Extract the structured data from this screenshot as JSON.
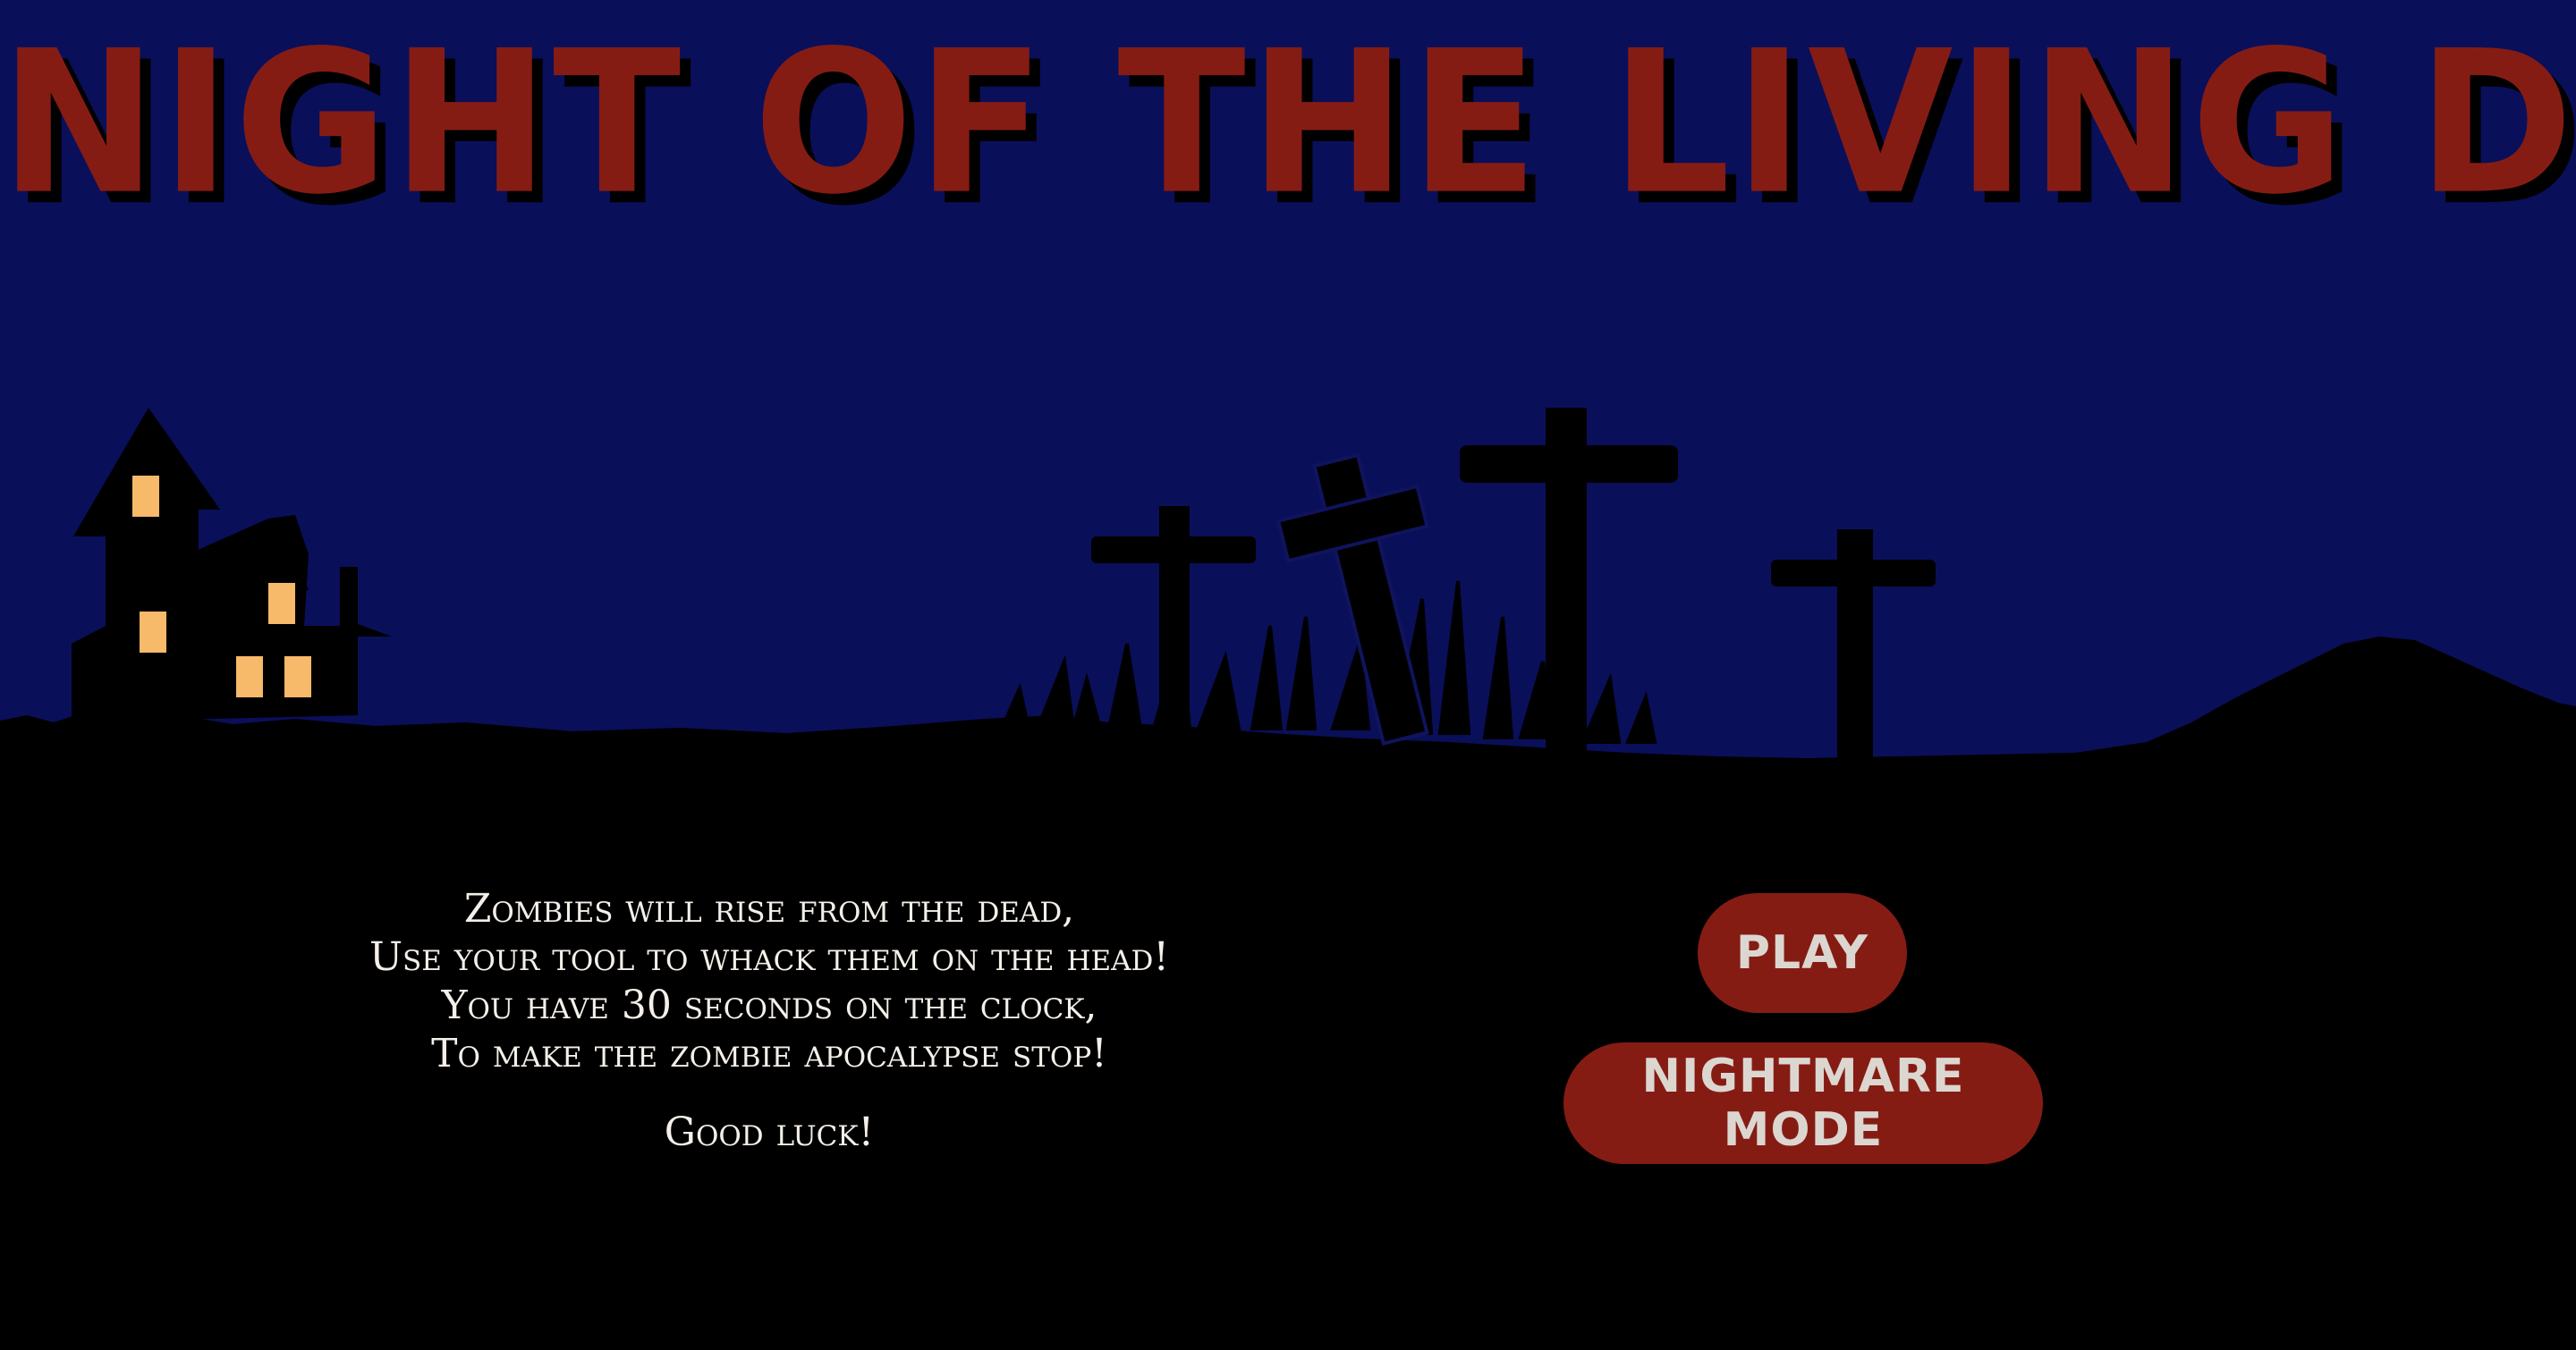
{
  "title": "NIGHT OF THE LIVING DEV",
  "rules": {
    "lines": [
      "Zombies will rise from the dead,",
      "Use your tool to whack them on the head!",
      "You have 30 seconds on the clock,",
      "To make the zombie apocalypse stop!"
    ],
    "good_luck": "Good luck!"
  },
  "buttons": {
    "play_label": "PLAY",
    "nightmare_label": "NIGHTMARE MODE"
  },
  "colors": {
    "sky": "#0a0f5a",
    "ground": "#000000",
    "title": "#851c14",
    "button_bg": "#851c14",
    "button_text": "#dcd6d0",
    "window_light": "#f7b96a",
    "rules_text": "#f4efe8"
  }
}
